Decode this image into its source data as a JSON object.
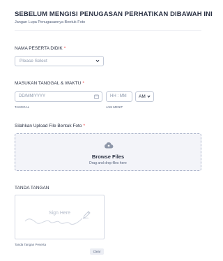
{
  "header": {
    "title": "SEBELUM MENGISI PENUGASAN PERHATIKAN DIBAWAH INI",
    "subtitle": "Jangan Lupa  Penugasannya Bentuk Foto"
  },
  "student": {
    "label": "NAMA PESERTA DIDIK",
    "required": "*",
    "placeholder": "Please Select"
  },
  "datetime": {
    "label": "MASUKAN TANGGAL & WAKTU",
    "required": "*",
    "date_placeholder": "DD/MM/YYYY",
    "time_placeholder": "HH : MM",
    "ampm_value": "AM",
    "date_sublabel": "TANGGAL",
    "time_sublabel": "JAM MENIT"
  },
  "upload": {
    "label": "Silahkan Upload File Bentuk Foto",
    "required": "*",
    "button_label": "Browse Files",
    "hint": "Drag and drop files here"
  },
  "signature": {
    "label": "TANDA TANGAN",
    "placeholder": "Sign Here",
    "sublabel": "Tanda Tangan Peserta",
    "clear_label": "Clear"
  },
  "icons": {
    "select_chevron": "chevron-down-icon",
    "calendar": "calendar-icon",
    "ampm_chevron": "chevron-down-icon",
    "upload": "cloud-upload-icon",
    "pen": "pen-icon"
  }
}
